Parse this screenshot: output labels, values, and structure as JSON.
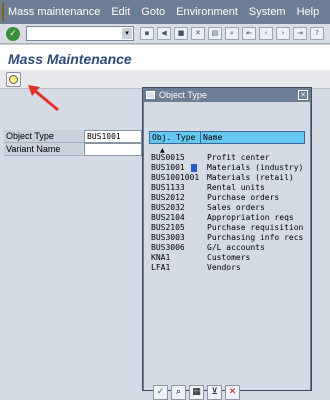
{
  "menubar": {
    "items": [
      "Mass maintenance",
      "Edit",
      "Goto",
      "Environment",
      "System",
      "Help"
    ]
  },
  "toolbar": {
    "command_value": "",
    "icons": [
      "ok-icon",
      "command-field",
      "back-icon",
      "exit-icon",
      "cancel-icon",
      "print-icon",
      "find-icon",
      "find-next-icon",
      "first-page-icon",
      "prev-page-icon",
      "next-page-icon",
      "last-page-icon",
      "help-icon"
    ]
  },
  "title": "Mass Maintenance",
  "form": {
    "object_type_label": "Object Type",
    "object_type_value": "BUS1001",
    "variant_name_label": "Variant Name",
    "variant_name_value": ""
  },
  "popup": {
    "title": "Object Type",
    "columns": [
      "Obj. Type",
      "Name"
    ],
    "rows": [
      {
        "type": "BUS0015",
        "name": "Profit center"
      },
      {
        "type": "BUS1001",
        "name": "Materials (industry)"
      },
      {
        "type": "BUS1001001",
        "name": "Materials (retail)"
      },
      {
        "type": "BUS1133",
        "name": "Rental units"
      },
      {
        "type": "BUS2012",
        "name": "Purchase orders"
      },
      {
        "type": "BUS2032",
        "name": "Sales orders"
      },
      {
        "type": "BUS2104",
        "name": "Appropriation reqs"
      },
      {
        "type": "BUS2105",
        "name": "Purchase requisition"
      },
      {
        "type": "BUS3003",
        "name": "Purchasing info recs"
      },
      {
        "type": "BUS3006",
        "name": "G/L accounts"
      },
      {
        "type": "KNA1",
        "name": "Customers"
      },
      {
        "type": "LFA1",
        "name": "Vendors"
      }
    ]
  },
  "colors": {
    "menubar": "#6c7e93",
    "header_cell": "#66c7f0",
    "title": "#2e4a7a",
    "content_bg": "#d5dbe5",
    "arrow": "#e4322b"
  }
}
